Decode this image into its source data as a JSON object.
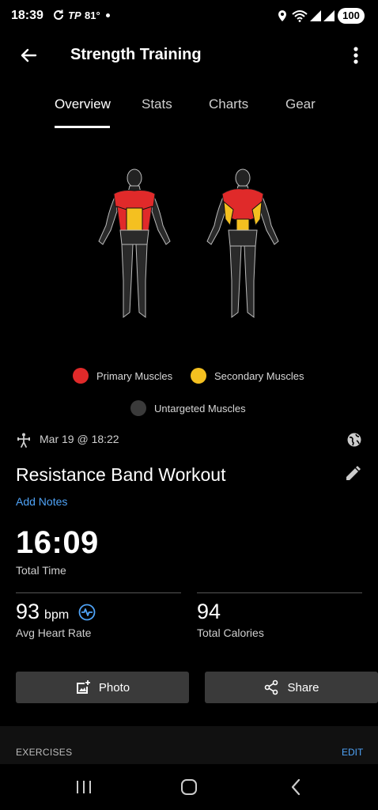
{
  "status_bar": {
    "time": "18:39",
    "tp": "TP",
    "temp": "81°",
    "battery": "100"
  },
  "app_bar": {
    "title": "Strength Training",
    "back_icon": "arrow-left-icon",
    "more_icon": "more-vertical-icon"
  },
  "tabs": [
    {
      "label": "Overview",
      "active": true
    },
    {
      "label": "Stats",
      "active": false
    },
    {
      "label": "Charts",
      "active": false
    },
    {
      "label": "Gear",
      "active": false
    }
  ],
  "legend": {
    "primary": {
      "label": "Primary Muscles",
      "color": "#e02a2a"
    },
    "secondary": {
      "label": "Secondary Muscles",
      "color": "#f4c020"
    },
    "untargeted": {
      "label": "Untargeted Muscles",
      "color": "#3a3a3a"
    }
  },
  "activity": {
    "date": "Mar 19 @ 18:22",
    "title": "Resistance Band Workout",
    "add_notes": "Add Notes"
  },
  "stats": {
    "total_time": {
      "value": "16:09",
      "label": "Total Time"
    },
    "avg_heart_rate": {
      "value": "93",
      "unit": "bpm",
      "label": "Avg Heart Rate"
    },
    "total_calories": {
      "value": "94",
      "label": "Total Calories"
    }
  },
  "actions": {
    "photo": "Photo",
    "share": "Share"
  },
  "exercises": {
    "label": "EXERCISES",
    "edit": "EDIT"
  },
  "colors": {
    "accent": "#4fa3f7",
    "button_bg": "#3a3a3a"
  }
}
